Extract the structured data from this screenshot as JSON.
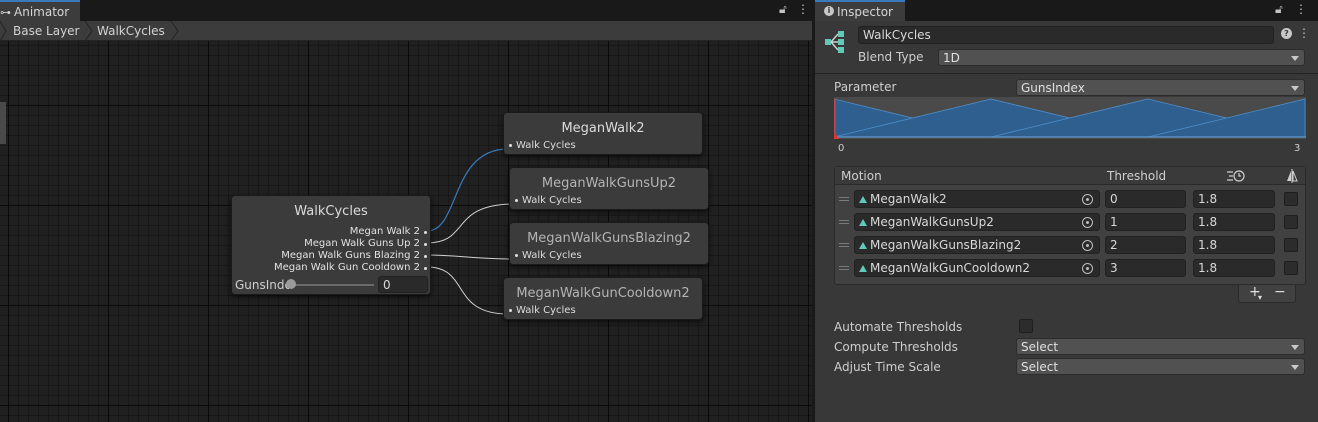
{
  "animator": {
    "tab_label": "Animator",
    "breadcrumbs": [
      "Base Layer",
      "WalkCycles"
    ],
    "source_node": {
      "title": "WalkCycles",
      "outputs": [
        "Megan Walk 2",
        "Megan Walk Guns Up 2",
        "Megan Walk Guns Blazing 2",
        "Megan Walk Gun Cooldown 2"
      ],
      "param_label": "GunsIndex",
      "param_value": "0"
    },
    "target_nodes": [
      {
        "title": "MeganWalk2",
        "port": "Walk Cycles"
      },
      {
        "title": "MeganWalkGunsUp2",
        "port": "Walk Cycles"
      },
      {
        "title": "MeganWalkGunsBlazing2",
        "port": "Walk Cycles"
      },
      {
        "title": "MeganWalkGunCooldown2",
        "port": "Walk Cycles"
      }
    ]
  },
  "inspector": {
    "tab_label": "Inspector",
    "name": "WalkCycles",
    "blend_type_label": "Blend Type",
    "blend_type_value": "1D",
    "parameter_label": "Parameter",
    "parameter_value": "GunsIndex",
    "graph_min": "0",
    "graph_max": "3",
    "table_header_motion": "Motion",
    "table_header_threshold": "Threshold",
    "motions": [
      {
        "clip": "MeganWalk2",
        "threshold": "0",
        "speed": "1.8"
      },
      {
        "clip": "MeganWalkGunsUp2",
        "threshold": "1",
        "speed": "1.8"
      },
      {
        "clip": "MeganWalkGunsBlazing2",
        "threshold": "2",
        "speed": "1.8"
      },
      {
        "clip": "MeganWalkGunCooldown2",
        "threshold": "3",
        "speed": "1.8"
      }
    ],
    "add_label": "+",
    "remove_label": "−",
    "automate_label": "Automate Thresholds",
    "compute_label": "Compute Thresholds",
    "compute_value": "Select",
    "adjust_label": "Adjust Time Scale",
    "adjust_value": "Select"
  },
  "colors": {
    "accent": "#3a79bb",
    "blend_fill": "#2e5f8f",
    "clip_icon": "#61c9b8",
    "marker": "#e0362f"
  }
}
